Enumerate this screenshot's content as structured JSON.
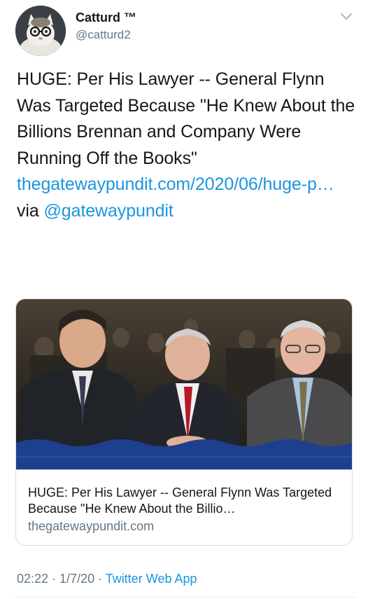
{
  "author": {
    "display_name": "Catturd ™",
    "handle": "@catturd2",
    "avatar_icon": "cat-with-glasses-avatar",
    "menu_icon": "chevron-down-icon"
  },
  "tweet": {
    "text": "HUGE: Per His Lawyer -- General Flynn Was Targeted Because \"He Knew About the Billions Brennan and Company Were Running Off the Books\" ",
    "link_text": "thegatewaypundit.com/​2020/06/huge-p…",
    "via_text": " via ",
    "mention": "@gatewaypundit"
  },
  "card": {
    "image_icon": "news-photo-three-men-seated",
    "title": "HUGE: Per His Lawyer -- General Flynn Was Targeted Because \"He Knew About the Billio…",
    "domain": "thegatewaypundit.com"
  },
  "meta": {
    "time": "02:22",
    "separator": " · ",
    "date": "1/7/20",
    "app": "Twitter Web App"
  },
  "colors": {
    "link": "#1b95e0",
    "text": "#14171a",
    "secondary": "#657786",
    "border": "#d8dee4"
  }
}
